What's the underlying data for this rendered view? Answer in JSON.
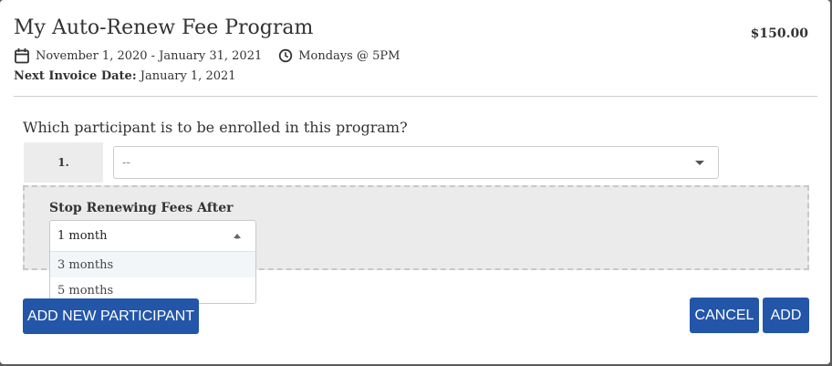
{
  "program": {
    "title": "My Auto-Renew Fee Program",
    "price": "$150.00",
    "date_range": "November 1, 2020 - January 31, 2021",
    "schedule": "Mondays @ 5PM",
    "next_invoice_label": "Next Invoice Date:",
    "next_invoice_value": "January 1, 2021"
  },
  "enrollment": {
    "question": "Which participant is to be enrolled in this program?",
    "row_number": "1.",
    "participant_value": "--"
  },
  "renew": {
    "label": "Stop Renewing Fees After",
    "selected": "1 month",
    "options": [
      "3 months",
      "5 months"
    ],
    "highlighted_option": "3 months"
  },
  "buttons": {
    "add_participant": "ADD NEW PARTICIPANT",
    "cancel": "CANCEL",
    "add": "ADD"
  },
  "colors": {
    "primary_button": "#2356a8",
    "box_background": "#ebebeb"
  },
  "icons": {
    "date": "calendar-icon",
    "time": "clock-icon"
  }
}
